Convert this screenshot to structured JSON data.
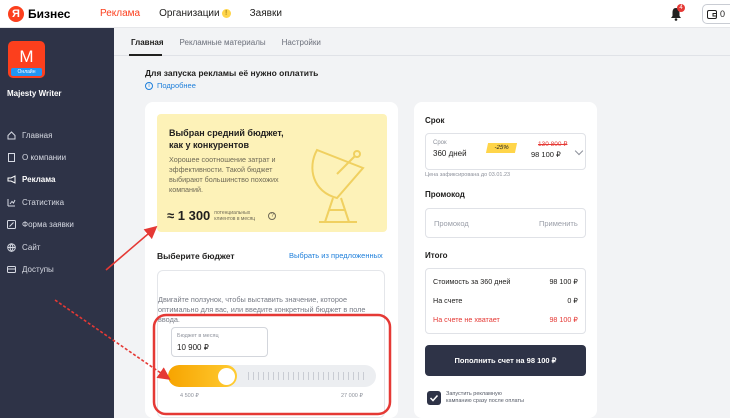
{
  "topbar": {
    "logo_letter": "Я",
    "logo_text": "Бизнес",
    "nav": [
      {
        "label": "Реклама",
        "active": true
      },
      {
        "label": "Организации",
        "badge": "!"
      },
      {
        "label": "Заявки"
      }
    ],
    "notifications_count": "4",
    "wallet_value": "0"
  },
  "sidebar": {
    "avatar_letter": "M",
    "avatar_tag": "Онлайн",
    "company": "Majesty Writer",
    "items": [
      {
        "label": "Главная",
        "icon": "home-icon"
      },
      {
        "label": "О компании",
        "icon": "document-icon"
      },
      {
        "label": "Реклама",
        "icon": "megaphone-icon",
        "active": true
      },
      {
        "label": "Статистика",
        "icon": "chart-icon"
      },
      {
        "label": "Форма заявки",
        "icon": "form-icon"
      },
      {
        "label": "Сайт",
        "icon": "globe-icon"
      },
      {
        "label": "Доступы",
        "icon": "key-icon"
      }
    ]
  },
  "tabs": [
    "Главная",
    "Рекламные материалы",
    "Настройки"
  ],
  "payment": {
    "title": "Для запуска рекламы её нужно оплатить",
    "more_link": "Подробнее"
  },
  "budget_card": {
    "promo_title": "Выбран средний бюджет, как у конкурентов",
    "promo_desc": "Хорошее соотношение затрат и эффективности. Такой бюджет выбирают большинство похожих компаний.",
    "reach_value": "≈ 1 300",
    "reach_caption": "потенциальных клиентов в месяц",
    "choose_title": "Выберите бюджет",
    "choose_link": "Выбрать из предложенных",
    "hint": "Двигайте ползунок, чтобы выставить значение, которое оптимально для вас, или введите конкретный бюджет в поле ввода.",
    "budget_label": "Бюджет в месяц",
    "budget_value": "10 900 ₽",
    "slider_min": "4 500 ₽",
    "slider_max": "27 000 ₽",
    "slider_level": 0.28
  },
  "order": {
    "term_title": "Срок",
    "term_label": "Срок",
    "term_days": "360 дней",
    "discount": "-25%",
    "old_price": "130 800 ₽",
    "new_price": "98 100 ₽",
    "term_note": "Цена зафиксирована до 03.01.23",
    "promo_title": "Промокод",
    "promo_placeholder": "Промокод",
    "promo_apply": "Применить",
    "total_title": "Итого",
    "rows": [
      {
        "label": "Стоимость за 360 дней",
        "value": "98 100 ₽"
      },
      {
        "label": "На счете",
        "value": "0 ₽"
      },
      {
        "label": "На счете не хватает",
        "value": "98 100 ₽"
      }
    ],
    "pay_button": "Пополнить счет на 98 100 ₽",
    "autostart_label": "Запустить рекламную кампанию сразу после оплаты"
  },
  "colors": {
    "accent": "#fc3f1d",
    "sidebar": "#2e3347",
    "annotation": "#e53935",
    "slider": "#f7a400"
  }
}
